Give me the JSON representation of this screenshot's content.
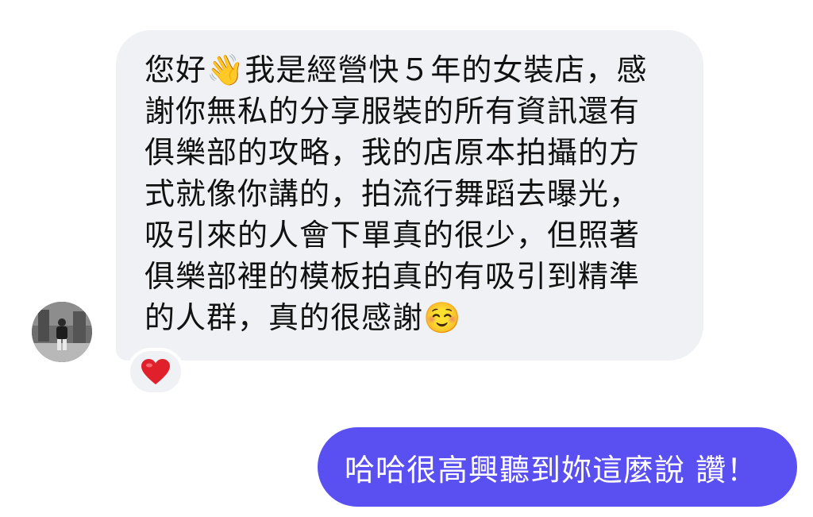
{
  "conversation": {
    "incoming": {
      "text": "您好👋我是經營快５年的女裝店，感\n謝你無私的分享服裝的所有資訊還有\n俱樂部的攻略，我的店原本拍攝的方\n式就像你講的，拍流行舞蹈去曝光，\n吸引來的人會下單真的很少，但照著\n俱樂部裡的模板拍真的有吸引到精準\n的人群，真的很感謝☺️",
      "reaction_icon": "heart-icon",
      "avatar_icon": "avatar-photo"
    },
    "outgoing": {
      "text": "哈哈很高興聽到妳這麼說 讚！"
    }
  },
  "colors": {
    "incoming_bubble": "#f0f1f4",
    "outgoing_bubble": "#5a4ff0",
    "heart": "#e0202a"
  }
}
